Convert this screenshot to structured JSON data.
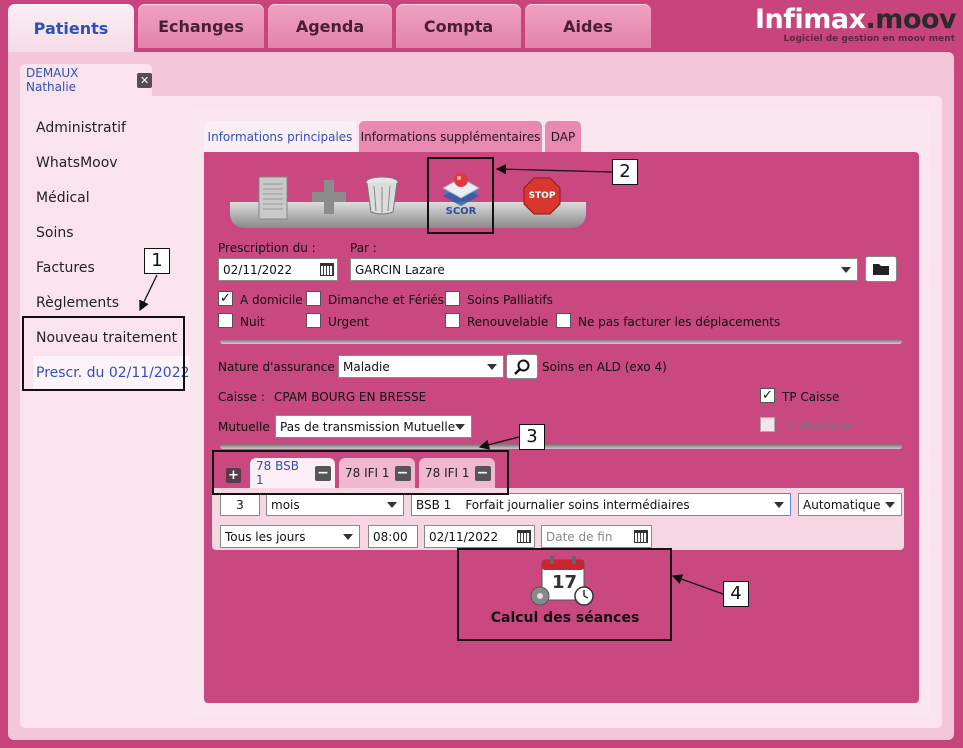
{
  "nav": {
    "tabs": [
      {
        "label": "Patients",
        "active": true
      },
      {
        "label": "Echanges",
        "active": false
      },
      {
        "label": "Agenda",
        "active": false
      },
      {
        "label": "Compta",
        "active": false
      },
      {
        "label": "Aides",
        "active": false
      }
    ]
  },
  "logo": {
    "name_part1": "Infimax",
    "name_part2": ".moov",
    "tagline": "Logiciel de gestion en moov ment"
  },
  "patient_tab": {
    "name": "DEMAUX Nathalie",
    "close_icon": "close-icon"
  },
  "left_menu": {
    "items": [
      "Administratif",
      "WhatsMoov",
      "Médical",
      "Soins",
      "Factures",
      "Règlements",
      "Nouveau traitement"
    ],
    "prescription": "Prescr. du 02/11/2022"
  },
  "sub_tabs": [
    "Informations principales",
    "Informations supplémentaires",
    "DAP"
  ],
  "toolbar": {
    "icons": [
      "document-icon",
      "add-icon",
      "trash-icon",
      "scor-icon",
      "stop-icon"
    ],
    "scor_label": "SCOR",
    "stop_label": "STOP"
  },
  "prescription": {
    "date_label": "Prescription du :",
    "date_value": "02/11/2022",
    "par_label": "Par :",
    "par_value": "GARCIN Lazare"
  },
  "checkboxes": [
    {
      "label": "A domicile",
      "checked": true
    },
    {
      "label": "Dimanche et Fériés",
      "checked": false
    },
    {
      "label": "Soins Palliatifs",
      "checked": false
    },
    {
      "label": "Nuit",
      "checked": false
    },
    {
      "label": "Urgent",
      "checked": false
    },
    {
      "label": "Renouvelable",
      "checked": false
    },
    {
      "label": "Ne pas facturer les déplacements",
      "checked": false
    }
  ],
  "assurance": {
    "nature_label": "Nature d'assurance :",
    "nature_value": "Maladie",
    "ald_text": "Soins en ALD (exo 4)",
    "caisse_label": "Caisse :",
    "caisse_value": "CPAM BOURG EN BRESSE",
    "tp_caisse_label": "TP Caisse",
    "tp_caisse_checked": true,
    "mutuelle_label": "Mutuelle :",
    "mutuelle_value": "Pas de transmission Mutuelle",
    "tp_mutuelle_label": "TP Mutuelle",
    "tp_mutuelle_checked": false
  },
  "soin_tabs": [
    {
      "label": "78 BSB 1",
      "active": true
    },
    {
      "label": "78 IFI 1",
      "active": false
    },
    {
      "label": "78 IFI 1",
      "active": false
    }
  ],
  "soin_detail": {
    "quantity": "3",
    "unit": "mois",
    "acte_code": "BSB 1",
    "acte_label": "Forfait journalier soins intermédiaires",
    "mode": "Automatique",
    "frequency": "Tous les jours",
    "time": "08:00",
    "start_date": "02/11/2022",
    "end_date_placeholder": "Date de fin"
  },
  "calcul": {
    "label": "Calcul des séances",
    "calendar_day": "17"
  },
  "annotations": [
    "1",
    "2",
    "3",
    "4"
  ]
}
